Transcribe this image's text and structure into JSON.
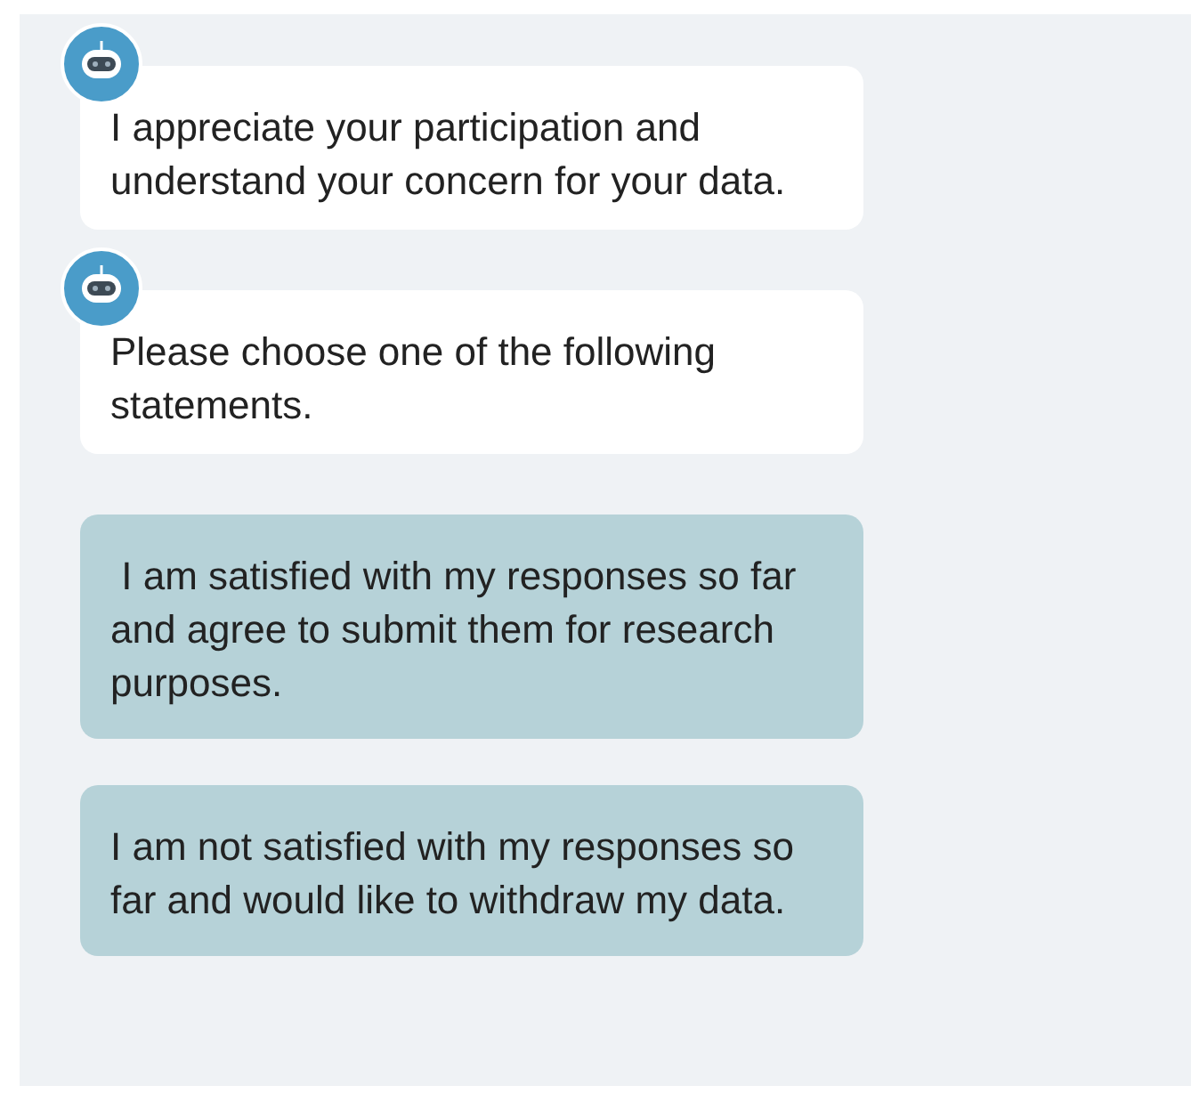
{
  "messages": [
    {
      "kind": "bot",
      "text": "I appreciate your participation and understand your concern for your data."
    },
    {
      "kind": "bot",
      "text": "Please choose one of the following statements."
    },
    {
      "kind": "option",
      "text": " I am satisfied with my responses so far  and agree to submit them for research purposes."
    },
    {
      "kind": "option",
      "text": "I am not satisfied with my responses so far and would like to withdraw my data."
    }
  ]
}
